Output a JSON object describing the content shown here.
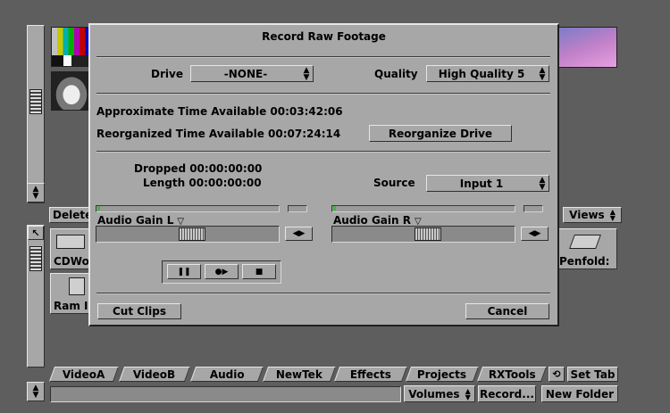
{
  "dialog": {
    "title": "Record Raw Footage",
    "drive_label": "Drive",
    "drive_value": "-NONE-",
    "quality_label": "Quality",
    "quality_value": "High Quality 5",
    "approx_time": "Approximate Time Available 00:03:42:06",
    "reorg_time": "Reorganized Time Available 00:07:24:14",
    "reorganize_button": "Reorganize Drive",
    "dropped": "Dropped 00:00:00:00",
    "length": "Length 00:00:00:00",
    "source_label": "Source",
    "source_value": "Input 1",
    "audio_gain_l": "Audio Gain L",
    "audio_gain_r": "Audio Gain R",
    "cut_clips_button": "Cut Clips",
    "cancel_button": "Cancel"
  },
  "background": {
    "delete_button": "Delete",
    "views_button": "Views",
    "folder_left_label": "CDWo",
    "ram_label": "Ram I",
    "penfold_label": "Penfold:"
  },
  "tabs": [
    "VideoA",
    "VideoB",
    "Audio",
    "NewTek",
    "Effects",
    "Projects",
    "RXTools"
  ],
  "set_tab_button": "Set Tab",
  "bottom_bar": {
    "volumes_button": "Volumes",
    "record_button": "Record...",
    "new_folder_button": "New Folder"
  },
  "colors": {
    "background": "#5e5e5e",
    "panel": "#a7a7a7",
    "meter_green": "#2fc02f"
  }
}
